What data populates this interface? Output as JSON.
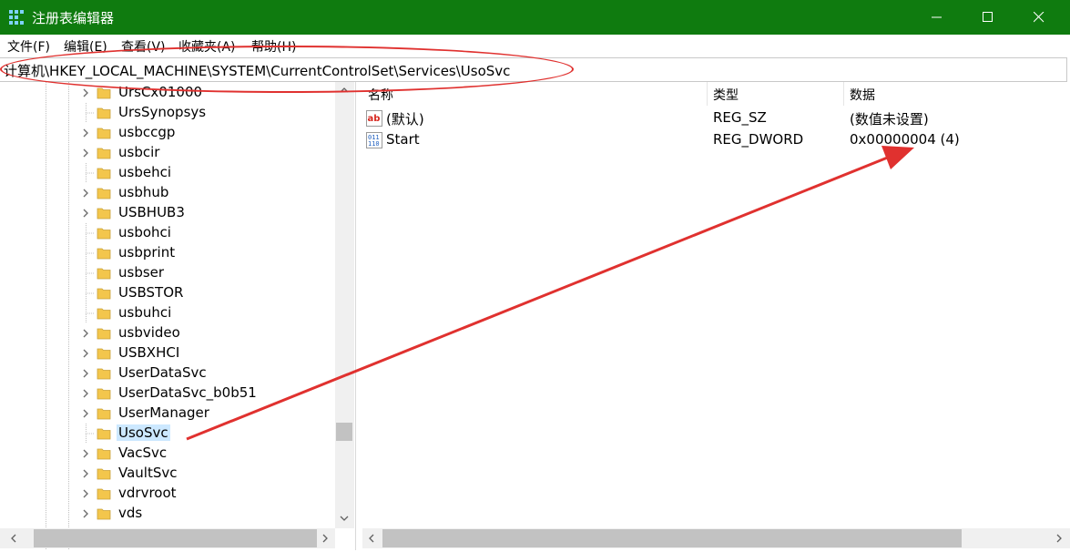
{
  "window": {
    "title": "注册表编辑器"
  },
  "menu": [
    "文件(F)",
    "编辑(E)",
    "查看(V)",
    "收藏夹(A)",
    "帮助(H)"
  ],
  "address": {
    "path": "计算机\\HKEY_LOCAL_MACHINE\\SYSTEM\\CurrentControlSet\\Services\\UsoSvc"
  },
  "tree": {
    "items": [
      {
        "label": "UrsCx01000",
        "expandable": true
      },
      {
        "label": "UrsSynopsys",
        "expandable": false
      },
      {
        "label": "usbccgp",
        "expandable": true
      },
      {
        "label": "usbcir",
        "expandable": true
      },
      {
        "label": "usbehci",
        "expandable": false
      },
      {
        "label": "usbhub",
        "expandable": true
      },
      {
        "label": "USBHUB3",
        "expandable": true
      },
      {
        "label": "usbohci",
        "expandable": false
      },
      {
        "label": "usbprint",
        "expandable": false
      },
      {
        "label": "usbser",
        "expandable": false
      },
      {
        "label": "USBSTOR",
        "expandable": false
      },
      {
        "label": "usbuhci",
        "expandable": false
      },
      {
        "label": "usbvideo",
        "expandable": true
      },
      {
        "label": "USBXHCI",
        "expandable": true
      },
      {
        "label": "UserDataSvc",
        "expandable": true
      },
      {
        "label": "UserDataSvc_b0b51",
        "expandable": true
      },
      {
        "label": "UserManager",
        "expandable": true
      },
      {
        "label": "UsoSvc",
        "expandable": false,
        "selected": true
      },
      {
        "label": "VacSvc",
        "expandable": true
      },
      {
        "label": "VaultSvc",
        "expandable": true
      },
      {
        "label": "vdrvroot",
        "expandable": true
      },
      {
        "label": "vds",
        "expandable": true
      }
    ]
  },
  "columns": {
    "name": "名称",
    "type": "类型",
    "data": "数据"
  },
  "values": [
    {
      "name": "(默认)",
      "type": "REG_SZ",
      "data": "(数值未设置)",
      "icon": "string-value-icon"
    },
    {
      "name": "Start",
      "type": "REG_DWORD",
      "data": "0x00000004 (4)",
      "icon": "binary-value-icon"
    }
  ],
  "colors": {
    "titlebar": "#0f7b0f",
    "annotation": "#e0312f",
    "selection": "#cce8ff",
    "folder": "#f3c64c"
  }
}
